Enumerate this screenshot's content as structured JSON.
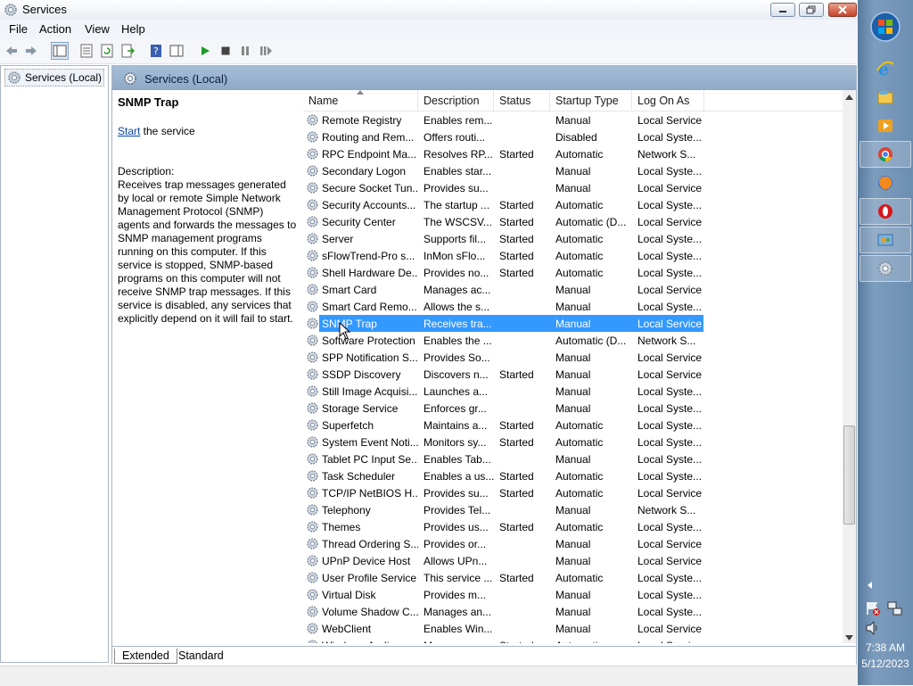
{
  "window": {
    "title": "Services"
  },
  "menu": [
    "File",
    "Action",
    "View",
    "Help"
  ],
  "tree": {
    "root_label": "Services (Local)"
  },
  "main_header": {
    "title": "Services (Local)"
  },
  "description_pane": {
    "service_name": "SNMP Trap",
    "start_link": "Start",
    "start_suffix": " the service",
    "description_label": "Description:",
    "description_text": "Receives trap messages generated by local or remote Simple Network Management Protocol (SNMP) agents and forwards the messages to SNMP management programs running on this computer. If this service is stopped, SNMP-based programs on this computer will not receive SNMP trap messages. If this service is disabled, any services that explicitly depend on it will fail to start."
  },
  "columns": {
    "name": "Name",
    "description": "Description",
    "status": "Status",
    "startup_type": "Startup Type",
    "log_on_as": "Log On As"
  },
  "services": [
    {
      "name": "Remote Registry",
      "description": "Enables rem...",
      "status": "",
      "startup": "Manual",
      "logon": "Local Service"
    },
    {
      "name": "Routing and Rem...",
      "description": "Offers routi...",
      "status": "",
      "startup": "Disabled",
      "logon": "Local Syste..."
    },
    {
      "name": "RPC Endpoint Ma...",
      "description": "Resolves RP...",
      "status": "Started",
      "startup": "Automatic",
      "logon": "Network S..."
    },
    {
      "name": "Secondary Logon",
      "description": "Enables star...",
      "status": "",
      "startup": "Manual",
      "logon": "Local Syste..."
    },
    {
      "name": "Secure Socket Tun...",
      "description": "Provides su...",
      "status": "",
      "startup": "Manual",
      "logon": "Local Service"
    },
    {
      "name": "Security Accounts...",
      "description": "The startup ...",
      "status": "Started",
      "startup": "Automatic",
      "logon": "Local Syste..."
    },
    {
      "name": "Security Center",
      "description": "The WSCSV...",
      "status": "Started",
      "startup": "Automatic (D...",
      "logon": "Local Service"
    },
    {
      "name": "Server",
      "description": "Supports fil...",
      "status": "Started",
      "startup": "Automatic",
      "logon": "Local Syste..."
    },
    {
      "name": "sFlowTrend-Pro s...",
      "description": "InMon sFlo...",
      "status": "Started",
      "startup": "Automatic",
      "logon": "Local Syste..."
    },
    {
      "name": "Shell Hardware De...",
      "description": "Provides no...",
      "status": "Started",
      "startup": "Automatic",
      "logon": "Local Syste..."
    },
    {
      "name": "Smart Card",
      "description": "Manages ac...",
      "status": "",
      "startup": "Manual",
      "logon": "Local Service"
    },
    {
      "name": "Smart Card Remo...",
      "description": "Allows the s...",
      "status": "",
      "startup": "Manual",
      "logon": "Local Syste..."
    },
    {
      "name": "SNMP Trap",
      "description": "Receives tra...",
      "status": "",
      "startup": "Manual",
      "logon": "Local Service",
      "selected": true
    },
    {
      "name": "Software Protection",
      "description": "Enables the ...",
      "status": "",
      "startup": "Automatic (D...",
      "logon": "Network S..."
    },
    {
      "name": "SPP Notification S...",
      "description": "Provides So...",
      "status": "",
      "startup": "Manual",
      "logon": "Local Service"
    },
    {
      "name": "SSDP Discovery",
      "description": "Discovers n...",
      "status": "Started",
      "startup": "Manual",
      "logon": "Local Service"
    },
    {
      "name": "Still Image Acquisi...",
      "description": "Launches a...",
      "status": "",
      "startup": "Manual",
      "logon": "Local Syste..."
    },
    {
      "name": "Storage Service",
      "description": "Enforces gr...",
      "status": "",
      "startup": "Manual",
      "logon": "Local Syste..."
    },
    {
      "name": "Superfetch",
      "description": "Maintains a...",
      "status": "Started",
      "startup": "Automatic",
      "logon": "Local Syste..."
    },
    {
      "name": "System Event Noti...",
      "description": "Monitors sy...",
      "status": "Started",
      "startup": "Automatic",
      "logon": "Local Syste..."
    },
    {
      "name": "Tablet PC Input Se...",
      "description": "Enables Tab...",
      "status": "",
      "startup": "Manual",
      "logon": "Local Syste..."
    },
    {
      "name": "Task Scheduler",
      "description": "Enables a us...",
      "status": "Started",
      "startup": "Automatic",
      "logon": "Local Syste..."
    },
    {
      "name": "TCP/IP NetBIOS H...",
      "description": "Provides su...",
      "status": "Started",
      "startup": "Automatic",
      "logon": "Local Service"
    },
    {
      "name": "Telephony",
      "description": "Provides Tel...",
      "status": "",
      "startup": "Manual",
      "logon": "Network S..."
    },
    {
      "name": "Themes",
      "description": "Provides us...",
      "status": "Started",
      "startup": "Automatic",
      "logon": "Local Syste..."
    },
    {
      "name": "Thread Ordering S...",
      "description": "Provides or...",
      "status": "",
      "startup": "Manual",
      "logon": "Local Service"
    },
    {
      "name": "UPnP Device Host",
      "description": "Allows UPn...",
      "status": "",
      "startup": "Manual",
      "logon": "Local Service"
    },
    {
      "name": "User Profile Service",
      "description": "This service ...",
      "status": "Started",
      "startup": "Automatic",
      "logon": "Local Syste..."
    },
    {
      "name": "Virtual Disk",
      "description": "Provides m...",
      "status": "",
      "startup": "Manual",
      "logon": "Local Syste..."
    },
    {
      "name": "Volume Shadow C...",
      "description": "Manages an...",
      "status": "",
      "startup": "Manual",
      "logon": "Local Syste..."
    },
    {
      "name": "WebClient",
      "description": "Enables Win...",
      "status": "",
      "startup": "Manual",
      "logon": "Local Service"
    },
    {
      "name": "Windows Audio",
      "description": "Manages au...",
      "status": "Started",
      "startup": "Automatic",
      "logon": "Local Service"
    }
  ],
  "tabs": [
    "Extended",
    "Standard"
  ],
  "clock": {
    "time": "7:38 AM",
    "date": "5/12/2023"
  },
  "colors": {
    "selection": "#3399ff",
    "header": "#9db6d0",
    "link": "#0645ad",
    "taskbar": "#6c8eb1"
  },
  "taskbar_icons": [
    "start-orb-icon",
    "internet-explorer-icon",
    "explorer-folder-icon",
    "media-player-icon",
    "chrome-icon",
    "firefox-icon",
    "opera-icon",
    "control-panel-icon",
    "services-gear-icon"
  ]
}
